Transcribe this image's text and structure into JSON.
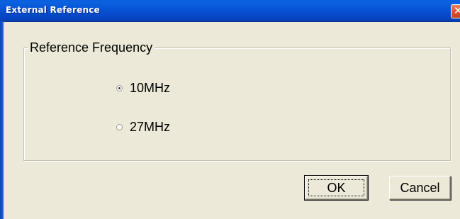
{
  "window": {
    "title": "External Reference",
    "close_glyph": "✕",
    "close_icon": "close-icon"
  },
  "group": {
    "label": "Reference Frequency",
    "options": [
      {
        "label": "10MHz",
        "checked": true
      },
      {
        "label": "27MHz",
        "checked": false
      }
    ]
  },
  "buttons": {
    "ok_label": "OK",
    "cancel_label": "Cancel"
  },
  "colors": {
    "titlebar": "#0853d4",
    "dialog_bg": "#ece9d8",
    "close_button": "#d3532e"
  }
}
